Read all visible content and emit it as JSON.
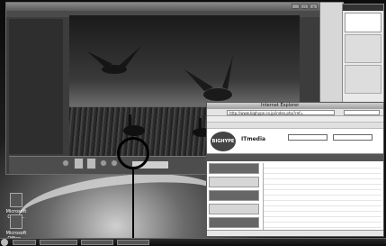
{
  "player": {
    "titlebar_text": "",
    "window_buttons": [
      "_",
      "□",
      "×"
    ],
    "timecode": ""
  },
  "desktop_icons": [
    {
      "label": "Microsoft Office..."
    },
    {
      "label": "Microsoft Office..."
    }
  ],
  "gadgets": {
    "header": "",
    "logo_text": "",
    "ad_text": ""
  },
  "ie": {
    "title": "Internet Explorer",
    "address": "http://www.bighype.co.jp/index.php?ref=",
    "nav_text": "",
    "toolbar_text": "",
    "site_name": "ITmedia",
    "site_logo": "BIGHYPE",
    "button_1": "",
    "button_2": "",
    "status": ""
  },
  "taskbar": {
    "clock": ""
  },
  "colors": {
    "callout": "#000000",
    "taskbar": "#0d0d0d"
  }
}
